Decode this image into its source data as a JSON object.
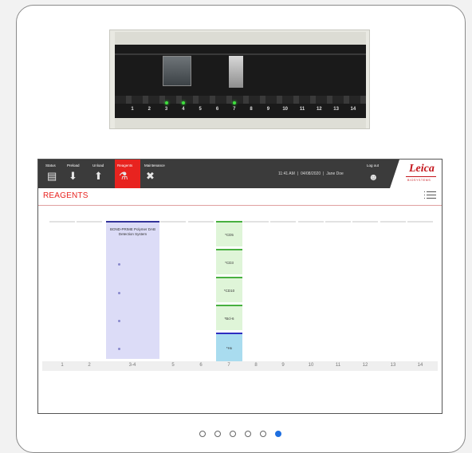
{
  "instrument": {
    "slot_numbers": [
      "1",
      "2",
      "3",
      "4",
      "5",
      "6",
      "7",
      "8",
      "9",
      "10",
      "11",
      "12",
      "13",
      "14"
    ],
    "lit_slots": [
      "3",
      "4",
      "7"
    ]
  },
  "topbar": {
    "nav": [
      {
        "label": "Status",
        "icon": "status-icon",
        "glyph": "▤"
      },
      {
        "label": "Preload",
        "icon": "preload-icon",
        "glyph": "⬇"
      },
      {
        "label": "Unload",
        "icon": "unload-icon",
        "glyph": "⬆"
      },
      {
        "label": "Reagents",
        "icon": "reagents-icon",
        "glyph": "⚗"
      },
      {
        "label": "Maintenance",
        "icon": "maintenance-icon",
        "glyph": "✖"
      }
    ],
    "active_tab": "Reagents",
    "time": "11:41 AM",
    "date": "04/08/2020",
    "user": "Jane Doe",
    "logout_label": "Log out",
    "logo": "Leica",
    "logo_sub": "BIOSYSTEMS"
  },
  "page": {
    "title": "REAGENTS"
  },
  "reagents": {
    "detection_system": "BOND-PRIME Polymer DAB Detection System",
    "tiles": [
      "*CD5",
      "*CD3",
      "*CD10",
      "*Bcl-6",
      "*Hx"
    ]
  },
  "positions": [
    "1",
    "2",
    "3-4",
    "5",
    "6",
    "7",
    "8",
    "9",
    "10",
    "11",
    "12",
    "13",
    "14"
  ],
  "pagination": {
    "total": 6,
    "active_index": 5
  },
  "colors": {
    "accent_red": "#e8231f",
    "topbar": "#3b3b3b",
    "detection_block": "#dcdcf7",
    "reagent_tile": "#dff5d8",
    "counterstain_tile": "#a9dcef",
    "active_dot": "#1e6fe0"
  }
}
